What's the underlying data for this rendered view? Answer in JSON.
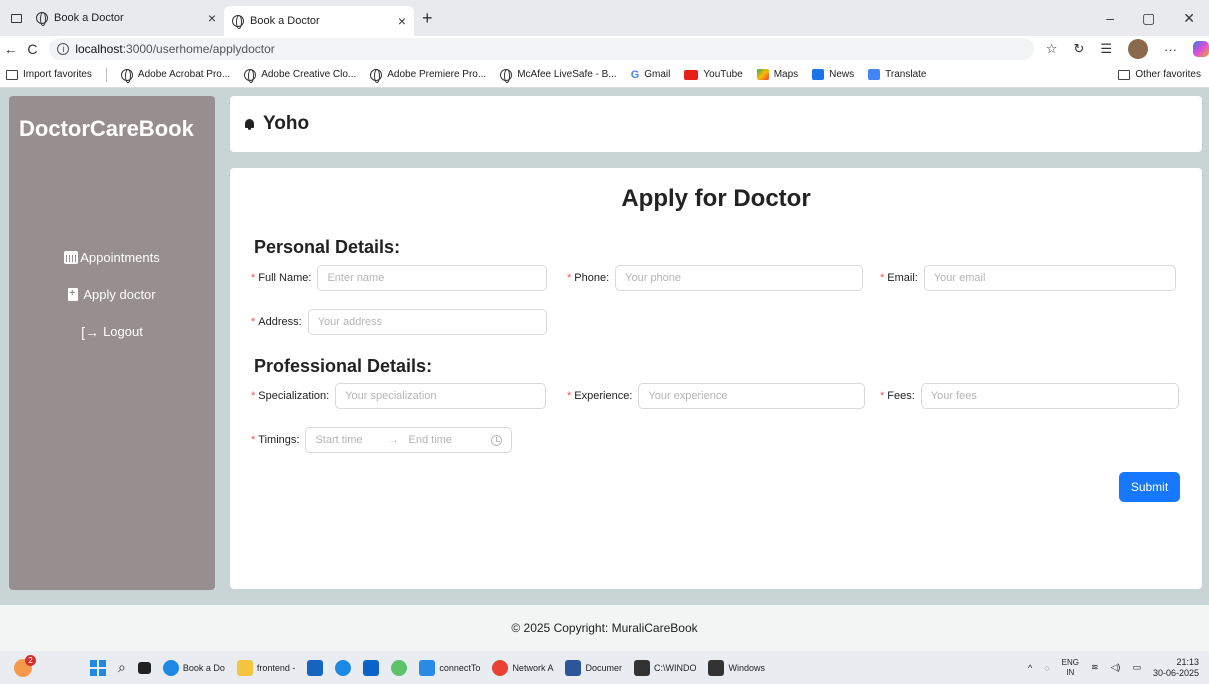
{
  "browser": {
    "tabs": [
      {
        "title": "Book a Doctor"
      },
      {
        "title": "Book a Doctor"
      }
    ],
    "close_glyph": "×",
    "new_tab_glyph": "+",
    "window_controls": {
      "minimize": "–",
      "maximize": "▢",
      "close": "✕"
    },
    "nav": {
      "back": "←",
      "reload": "C"
    },
    "url": {
      "host": "localhost",
      "path": ":3000/userhome/applydoctor"
    },
    "favorites": [
      {
        "label": "Import favorites"
      },
      {
        "label": "Adobe Acrobat Pro..."
      },
      {
        "label": "Adobe Creative Clo..."
      },
      {
        "label": "Adobe Premiere Pro..."
      },
      {
        "label": "McAfee LiveSafe - B..."
      },
      {
        "label": "Gmail"
      },
      {
        "label": "YouTube"
      },
      {
        "label": "Maps"
      },
      {
        "label": "News"
      },
      {
        "label": "Translate"
      }
    ],
    "other_favorites": "Other favorites"
  },
  "app": {
    "brand": "DoctorCareBook",
    "menu": [
      {
        "label": "Appointments"
      },
      {
        "label": "Apply doctor"
      },
      {
        "label": "Logout"
      }
    ],
    "header_user": "Yoho",
    "page_title": "Apply for Doctor",
    "personal_title": "Personal Details:",
    "professional_title": "Professional Details:",
    "fields": {
      "full_name": {
        "label": "Full Name:",
        "placeholder": "Enter name",
        "value": ""
      },
      "phone": {
        "label": "Phone:",
        "placeholder": "Your phone",
        "value": ""
      },
      "email": {
        "label": "Email:",
        "placeholder": "Your email",
        "value": ""
      },
      "address": {
        "label": "Address:",
        "placeholder": "Your address",
        "value": ""
      },
      "specialization": {
        "label": "Specialization:",
        "placeholder": "Your specialization",
        "value": ""
      },
      "experience": {
        "label": "Experience:",
        "placeholder": "Your experience",
        "value": ""
      },
      "fees": {
        "label": "Fees:",
        "placeholder": "Your fees",
        "value": ""
      },
      "timings": {
        "label": "Timings:",
        "start_placeholder": "Start time",
        "end_placeholder": "End time"
      }
    },
    "required_mark": "*",
    "submit_label": "Submit",
    "footer": "© 2025 Copyright: MuraliCareBook",
    "colors": {
      "sidebar": "#978e8f",
      "primary": "#1677ff",
      "required": "#ff4d4f"
    }
  },
  "taskbar": {
    "weather_badge": "2",
    "apps": [
      {
        "label": "Book a Do"
      },
      {
        "label": "frontend -"
      },
      {
        "label": "connectTo"
      },
      {
        "label": "Network A"
      },
      {
        "label": "Documer"
      },
      {
        "label": "C:\\WINDO"
      },
      {
        "label": "Windows"
      }
    ],
    "lang_top": "ENG",
    "lang_bottom": "IN",
    "time": "21:13",
    "date": "30-06-2025"
  }
}
